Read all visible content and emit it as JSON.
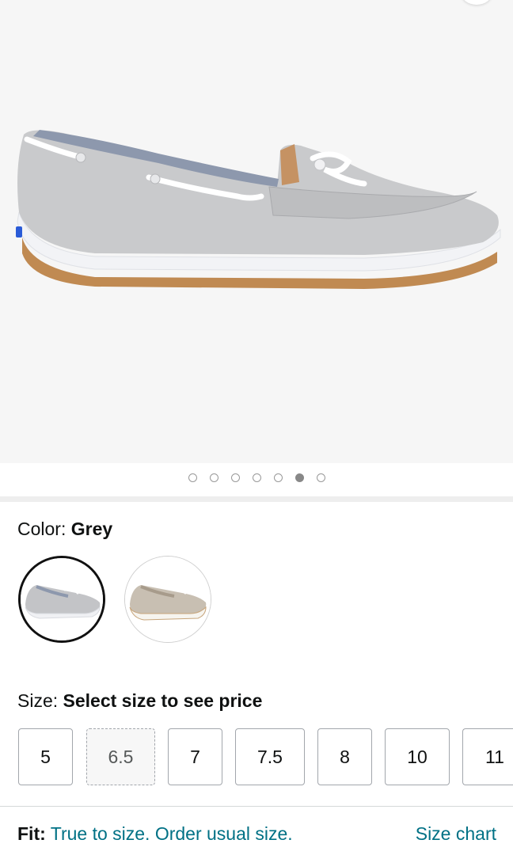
{
  "product": {
    "image_alt": "Grey canvas boat shoe",
    "carousel": {
      "count": 7,
      "active_index": 5
    }
  },
  "color": {
    "label": "Color:",
    "value": "Grey",
    "swatches": [
      {
        "name": "grey-swatch",
        "selected": true
      },
      {
        "name": "taupe-swatch",
        "selected": false
      }
    ]
  },
  "size": {
    "label": "Size:",
    "prompt": "Select size to see price",
    "options": [
      {
        "label": "5",
        "available": true
      },
      {
        "label": "6.5",
        "available": false
      },
      {
        "label": "7",
        "available": true
      },
      {
        "label": "7.5",
        "available": true
      },
      {
        "label": "8",
        "available": true
      },
      {
        "label": "10",
        "available": true
      },
      {
        "label": "11",
        "available": true
      }
    ]
  },
  "fit": {
    "label": "Fit:",
    "value": "True to size. Order usual size.",
    "size_chart_link": "Size chart"
  },
  "colors": {
    "link": "#007185",
    "text": "#0f1111",
    "hero_bg": "#f6f6f6"
  }
}
